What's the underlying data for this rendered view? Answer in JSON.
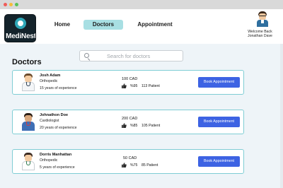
{
  "window": {
    "title": ""
  },
  "logo": {
    "text": "MediNest"
  },
  "nav": {
    "home": "Home",
    "doctors": "Doctors",
    "appointment": "Appointment",
    "active": "Doctors"
  },
  "user": {
    "welcome": "Welcome Back",
    "name": "Jonathan Dave"
  },
  "search": {
    "placeholder": "Search for doctors"
  },
  "page": {
    "title": "Doctors"
  },
  "doctors": [
    {
      "name": "Josh Adam",
      "specialty": "Orthopedic",
      "experience": "15 years of experience",
      "price": "100 CAD",
      "rating": "%95",
      "patients": "113 Patient",
      "button": "Book Appointment"
    },
    {
      "name": "Johnathon Doe",
      "specialty": "Cardiologist",
      "experience": "20 years of experience",
      "price": "200 CAD",
      "rating": "%85",
      "patients": "105 Patient",
      "button": "Book Appointment"
    },
    {
      "name": "Dorris Manhattan",
      "specialty": "Orthopedic",
      "experience": "5 years of experience",
      "price": "50 CAD",
      "rating": "%75",
      "patients": "85 Patient",
      "button": "Book Appointment"
    }
  ],
  "colors": {
    "accent": "#3d63e3",
    "nav_active": "#a8dfe3",
    "card_border": "#7fcdd4",
    "background": "#eef4f8"
  }
}
